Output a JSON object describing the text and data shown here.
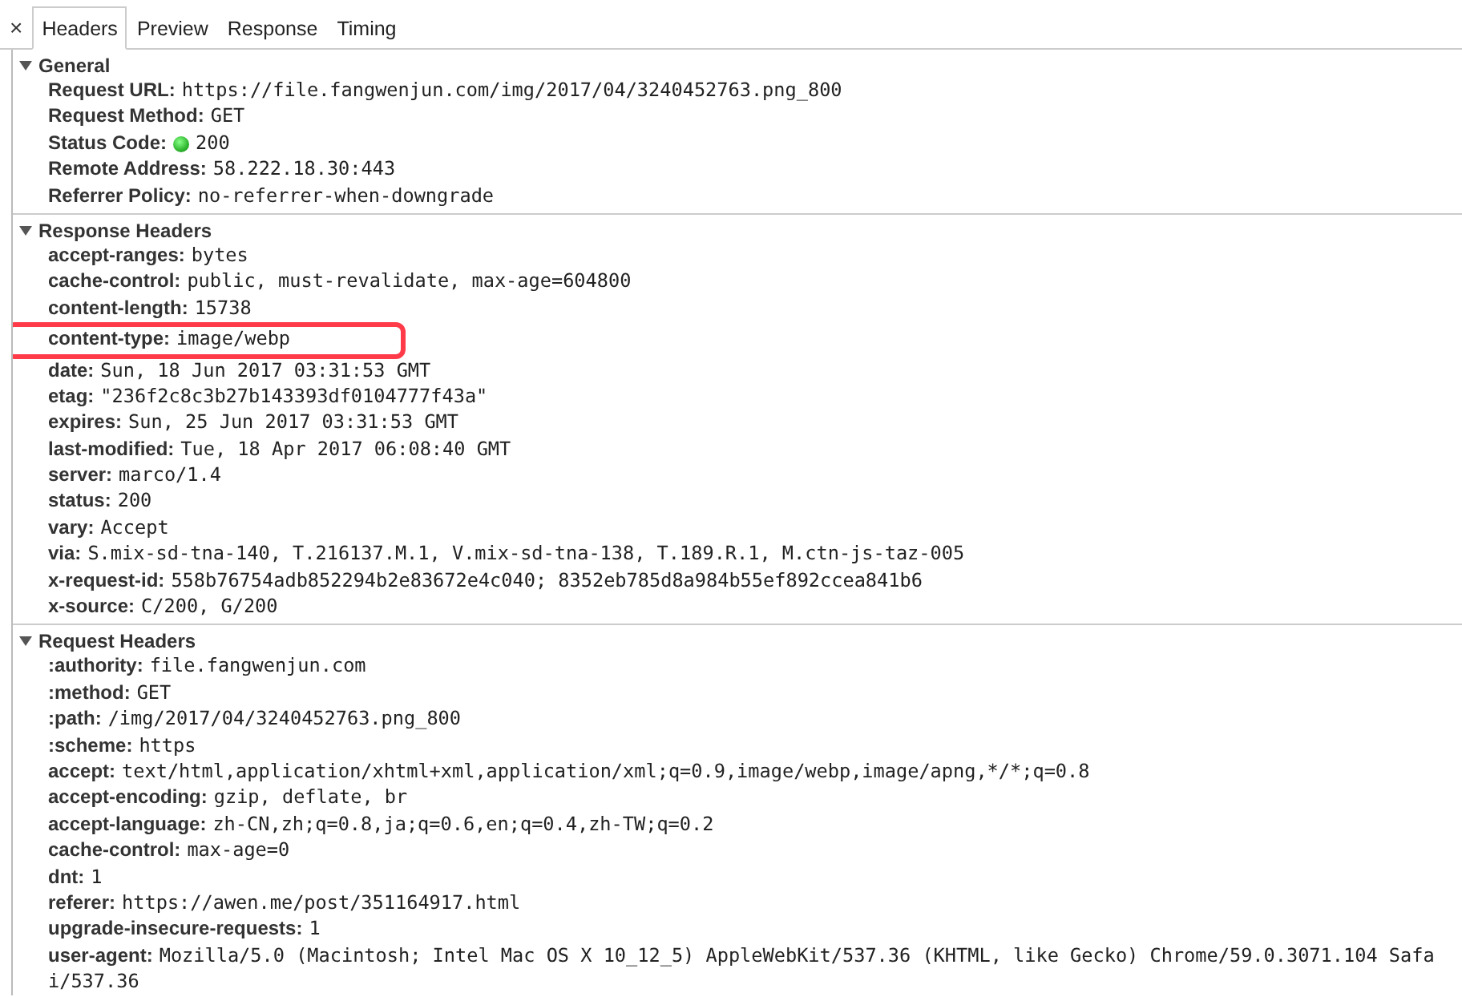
{
  "close_button": "×",
  "tabs": [
    {
      "label": "Headers",
      "selected": true
    },
    {
      "label": "Preview",
      "selected": false
    },
    {
      "label": "Response",
      "selected": false
    },
    {
      "label": "Timing",
      "selected": false
    }
  ],
  "sections": [
    {
      "title": "General",
      "expanded": true,
      "rows": [
        {
          "name": "Request URL:",
          "value": "https://file.fangwenjun.com/img/2017/04/3240452763.png_800"
        },
        {
          "name": "Request Method:",
          "value": "GET"
        },
        {
          "name": "Status Code:",
          "value": "200",
          "status_icon": true
        },
        {
          "name": "Remote Address:",
          "value": "58.222.18.30:443"
        },
        {
          "name": "Referrer Policy:",
          "value": "no-referrer-when-downgrade"
        }
      ]
    },
    {
      "title": "Response Headers",
      "expanded": true,
      "rows": [
        {
          "name": "accept-ranges:",
          "value": "bytes"
        },
        {
          "name": "cache-control:",
          "value": "public, must-revalidate, max-age=604800"
        },
        {
          "name": "content-length:",
          "value": "15738"
        },
        {
          "name": "content-type:",
          "value": "image/webp",
          "highlighted": true
        },
        {
          "name": "date:",
          "value": "Sun, 18 Jun 2017 03:31:53 GMT"
        },
        {
          "name": "etag:",
          "value": "\"236f2c8c3b27b143393df0104777f43a\""
        },
        {
          "name": "expires:",
          "value": "Sun, 25 Jun 2017 03:31:53 GMT"
        },
        {
          "name": "last-modified:",
          "value": "Tue, 18 Apr 2017 06:08:40 GMT"
        },
        {
          "name": "server:",
          "value": "marco/1.4"
        },
        {
          "name": "status:",
          "value": "200"
        },
        {
          "name": "vary:",
          "value": "Accept"
        },
        {
          "name": "via:",
          "value": "S.mix-sd-tna-140, T.216137.M.1, V.mix-sd-tna-138, T.189.R.1, M.ctn-js-taz-005"
        },
        {
          "name": "x-request-id:",
          "value": "558b76754adb852294b2e83672e4c040; 8352eb785d8a984b55ef892ccea841b6"
        },
        {
          "name": "x-source:",
          "value": "C/200, G/200"
        }
      ]
    },
    {
      "title": "Request Headers",
      "expanded": true,
      "rows": [
        {
          "name": ":authority:",
          "value": "file.fangwenjun.com"
        },
        {
          "name": ":method:",
          "value": "GET"
        },
        {
          "name": ":path:",
          "value": "/img/2017/04/3240452763.png_800"
        },
        {
          "name": ":scheme:",
          "value": "https"
        },
        {
          "name": "accept:",
          "value": "text/html,application/xhtml+xml,application/xml;q=0.9,image/webp,image/apng,*/*;q=0.8"
        },
        {
          "name": "accept-encoding:",
          "value": "gzip, deflate, br"
        },
        {
          "name": "accept-language:",
          "value": "zh-CN,zh;q=0.8,ja;q=0.6,en;q=0.4,zh-TW;q=0.2"
        },
        {
          "name": "cache-control:",
          "value": "max-age=0"
        },
        {
          "name": "dnt:",
          "value": "1"
        },
        {
          "name": "referer:",
          "value": "https://awen.me/post/351164917.html"
        },
        {
          "name": "upgrade-insecure-requests:",
          "value": "1"
        },
        {
          "name": "user-agent:",
          "value": "Mozilla/5.0 (Macintosh; Intel Mac OS X 10_12_5) AppleWebKit/537.36 (KHTML, like Gecko) Chrome/59.0.3071.104 Safa",
          "continuation": "i/537.36"
        }
      ]
    }
  ]
}
